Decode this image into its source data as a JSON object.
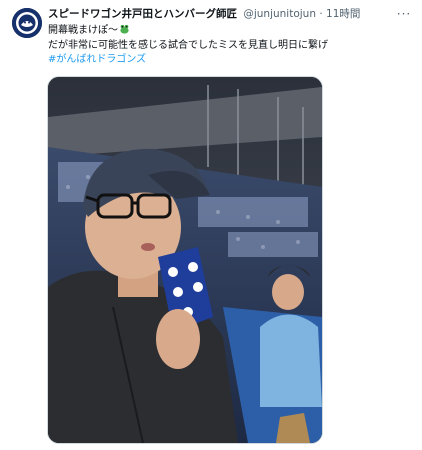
{
  "tweet": {
    "display_name": "スピードワゴン井戸田とハンバーグ師匠",
    "handle": "@junjunitojun",
    "separator": "·",
    "time": "11時間",
    "more_icon": "more-horizontal-icon",
    "avatar_icon": "avatar-logo",
    "line1": "開幕戦まけぽ〜",
    "line1_emoji": "frog-icon",
    "line2": "だが非常に可能性を感じる試合でしたミスを見直し明日に繋げ",
    "hashtag": "#がんばれドラゴンズ",
    "photo_alt": "stadium-selfie-photo",
    "colors": {
      "text": "#0f1419",
      "secondary": "#536471",
      "link": "#1d9bf0",
      "border": "#cfd9de"
    }
  }
}
